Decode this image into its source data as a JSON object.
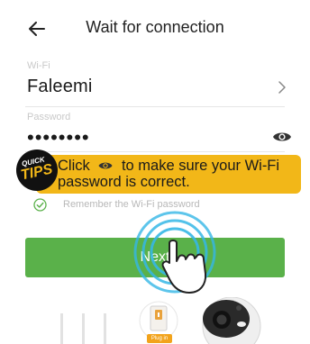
{
  "header": {
    "title": "Wait for connection",
    "back_icon": "back-arrow-icon"
  },
  "form": {
    "wifi_label": "Wi-Fi",
    "wifi_value": "Faleemi",
    "password_label": "Password",
    "password_value": "••••••••",
    "remember_label": "Remember the Wi-Fi password",
    "remember_checked": true
  },
  "tips": {
    "badge_top": "QUICK",
    "badge_bottom": "TIPS",
    "line1_before": "Click",
    "line1_after": "to make sure your Wi-Fi",
    "line2": "password is correct."
  },
  "next_button": {
    "label": "Next"
  },
  "illustration": {
    "plug_label": "Plug in"
  },
  "colors": {
    "accent_green": "#5ab14a",
    "tips_yellow": "#f2b718",
    "label_gray": "#c9c9c9"
  }
}
